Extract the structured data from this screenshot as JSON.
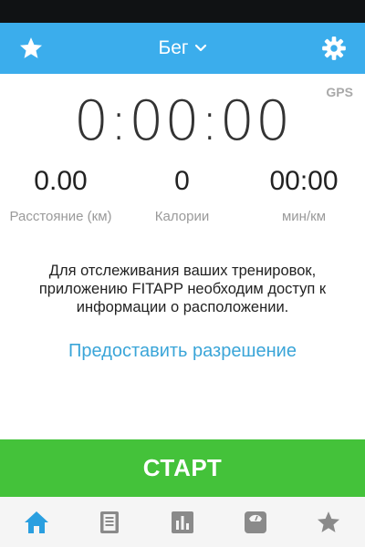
{
  "header": {
    "title": "Бег",
    "icons": {
      "left": "star-icon",
      "title_suffix": "chevron-down-icon",
      "right": "gear-icon"
    }
  },
  "gps_label": "GPS",
  "timer": "0:00:00",
  "stats": [
    {
      "value": "0.00",
      "label": "Расстояние (км)"
    },
    {
      "value": "0",
      "label": "Калории"
    },
    {
      "value": "00:00",
      "label": "мин/км"
    }
  ],
  "permission": {
    "message": "Для отслеживания ваших тренировок, приложению FITAPP необходим доступ к информации о расположении.",
    "link": "Предоставить разрешение"
  },
  "start_button": "СТАРТ",
  "tabs": [
    {
      "icon": "home-icon",
      "active": true
    },
    {
      "icon": "list-icon",
      "active": false
    },
    {
      "icon": "bar-chart-icon",
      "active": false
    },
    {
      "icon": "scale-icon",
      "active": false
    },
    {
      "icon": "star-icon",
      "active": false
    }
  ],
  "colors": {
    "header": "#3badec",
    "start_button": "#44c23a",
    "link": "#3aa5d8",
    "tab_active": "#2a9fe0",
    "tab_inactive": "#8a8a8a"
  }
}
